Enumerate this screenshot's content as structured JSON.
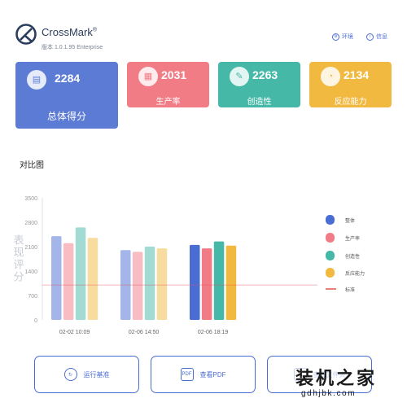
{
  "app": {
    "name": "CrossMark",
    "registered": "®",
    "version": "版本 1.0.1.95 Enterprise"
  },
  "header": {
    "env_label": "环境",
    "info_label": "信息"
  },
  "cards": [
    {
      "name": "overall",
      "score": "2284",
      "label": "总体得分",
      "color": "#5b7bd5",
      "icon": "clipboard-icon"
    },
    {
      "name": "productivity",
      "score": "2031",
      "label": "生产率",
      "color": "#f27c85",
      "icon": "document-icon"
    },
    {
      "name": "creativity",
      "score": "2263",
      "label": "创造性",
      "color": "#45b8a7",
      "icon": "brush-icon"
    },
    {
      "name": "responsiveness",
      "score": "2134",
      "label": "反应能力",
      "color": "#f2b940",
      "icon": "gauge-icon"
    }
  ],
  "section_title": "对比图",
  "chart_data": {
    "type": "bar",
    "ylabel": "表现评分",
    "yticks": [
      "3500",
      "2800",
      "2100",
      "1400",
      "700",
      "0"
    ],
    "ylim": [
      0,
      3500
    ],
    "categories": [
      "02-02 10:09",
      "02-06 14:50",
      "02-06 18:19"
    ],
    "series": [
      {
        "name": "整体",
        "color": "#4a6dd4",
        "values": [
          2400,
          2000,
          2150
        ]
      },
      {
        "name": "生产率",
        "color": "#f27c85",
        "values": [
          2200,
          1950,
          2050
        ]
      },
      {
        "name": "创造性",
        "color": "#45b8a7",
        "values": [
          2650,
          2100,
          2250
        ]
      },
      {
        "name": "反应能力",
        "color": "#f2b940",
        "values": [
          2350,
          2050,
          2130
        ]
      }
    ],
    "baseline": {
      "name": "标准",
      "value": 1000,
      "color": "#e05555"
    },
    "legend_position": "right",
    "grid": false
  },
  "buttons": {
    "run": "运行基准",
    "pdf": "查看PDF",
    "pdf_icon_text": "PDF",
    "third": "查看文件夹"
  },
  "watermark": {
    "text": "装机之家",
    "url": "gdhjbk.com"
  }
}
